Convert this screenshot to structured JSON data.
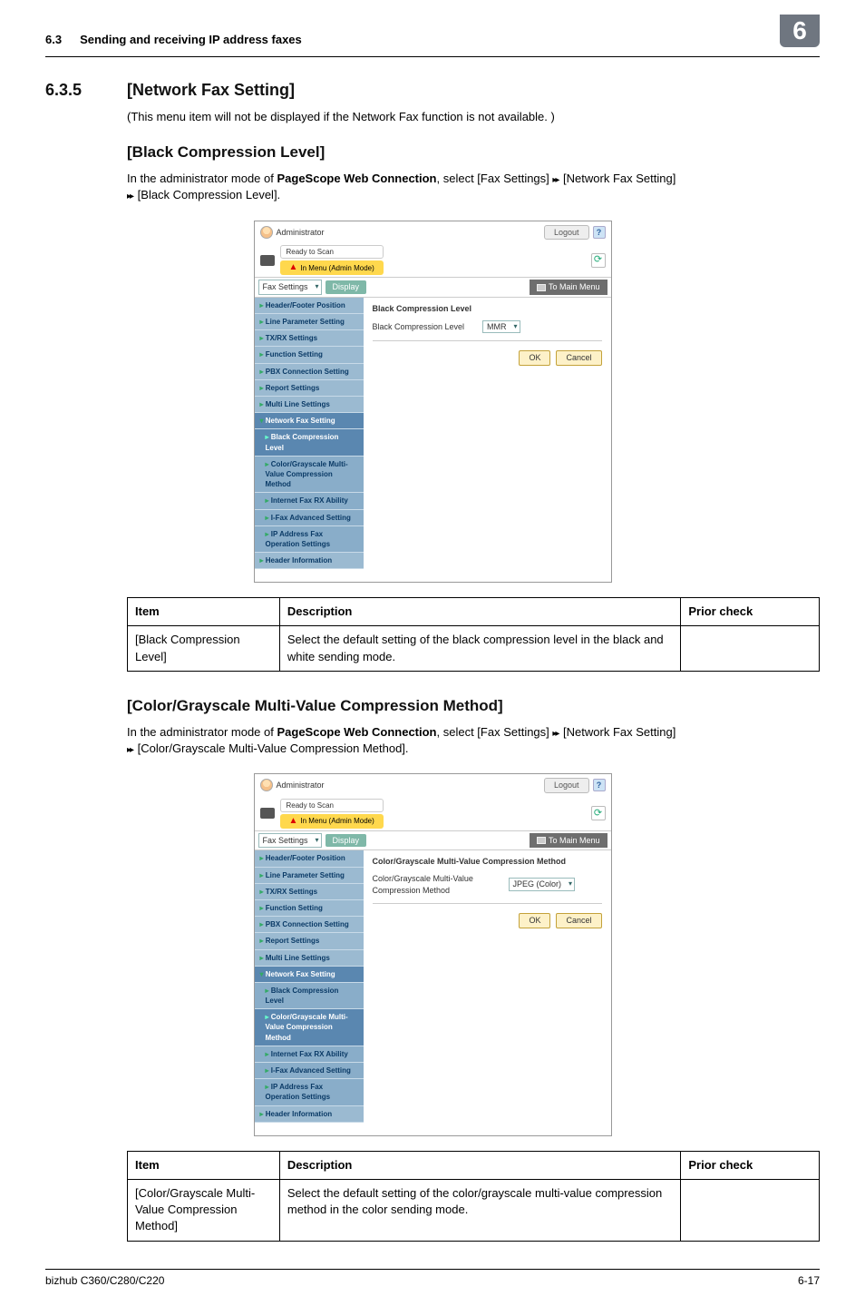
{
  "header": {
    "number": "6.3",
    "title": "Sending and receiving IP address faxes",
    "chapter": "6"
  },
  "section": {
    "number": "6.3.5",
    "title": "[Network Fax Setting]",
    "intro": "(This menu item will not be displayed if the Network Fax function is not available. )"
  },
  "sub1": {
    "title": "[Black Compression Level]",
    "intro_a": "In the administrator mode of ",
    "intro_bold": "PageScope Web Connection",
    "intro_b": ", select [Fax Settings] ",
    "intro_c": " [Network Fax Setting] ",
    "intro_d": " [Black Compression Level]."
  },
  "sub2": {
    "title": "[Color/Grayscale Multi-Value Compression Method]",
    "intro_a": "In the administrator mode of ",
    "intro_bold": "PageScope Web Connection",
    "intro_b": ", select [Fax Settings] ",
    "intro_c": " [Network Fax Setting] ",
    "intro_d": " [Color/Grayscale Multi-Value Compression Method]."
  },
  "table_headers": {
    "item": "Item",
    "description": "Description",
    "prior": "Prior check"
  },
  "table1": {
    "item": "[Black Compression Level]",
    "desc": "Select the default setting of the black compression level in the black and white sending mode.",
    "prior": ""
  },
  "table2": {
    "item": "[Color/Grayscale Multi-Value Compression Method]",
    "desc": "Select the default setting of the color/grayscale multi-value compression method in the color sending mode.",
    "prior": ""
  },
  "screenshot_common": {
    "admin": "Administrator",
    "logout": "Logout",
    "ready": "Ready to Scan",
    "mode": "In Menu (Admin Mode)",
    "fax_settings": "Fax Settings",
    "display": "Display",
    "to_main_menu": "To Main Menu",
    "ok": "OK",
    "cancel": "Cancel",
    "side": {
      "header_footer": "Header/Footer Position",
      "line_param": "Line Parameter Setting",
      "txrx": "TX/RX Settings",
      "function": "Function Setting",
      "pbx": "PBX Connection Setting",
      "report": "Report Settings",
      "multiline": "Multi Line Settings",
      "network_fax": "Network Fax Setting",
      "black_comp": "Black Compression Level",
      "color_gray": "Color/Grayscale Multi-Value Compression Method",
      "ifax_rx": "Internet Fax RX Ability",
      "ifax_adv": "I-Fax Advanced Setting",
      "ip_addr_fax": "IP Address Fax Operation Settings",
      "header_info": "Header Information"
    }
  },
  "screenshot1": {
    "panel_title": "Black Compression Level",
    "row_label": "Black Compression Level",
    "select_value": "MMR"
  },
  "screenshot2": {
    "panel_title": "Color/Grayscale Multi-Value Compression Method",
    "row_label": "Color/Grayscale Multi-Value Compression Method",
    "select_value": "JPEG (Color)"
  },
  "footer": {
    "product": "bizhub C360/C280/C220",
    "page": "6-17"
  }
}
